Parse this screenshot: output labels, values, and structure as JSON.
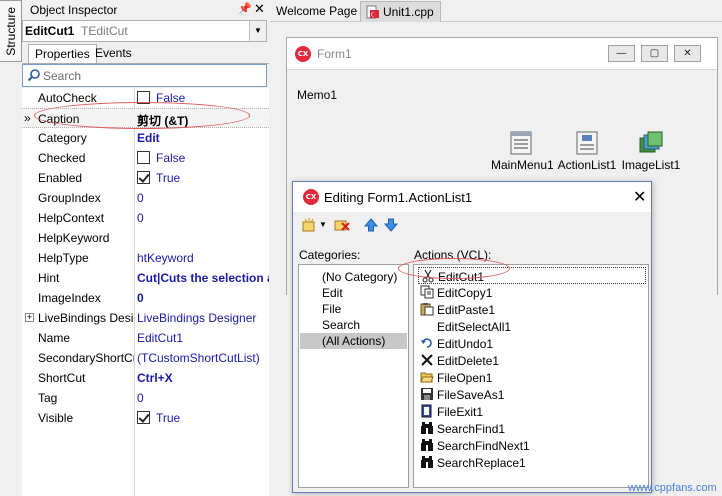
{
  "structure_tab": {
    "label": "Structure"
  },
  "object_inspector": {
    "title": "Object Inspector",
    "selected_component": {
      "name": "EditCut1",
      "class": "TEditCut"
    },
    "tabs": [
      {
        "label": "Properties"
      },
      {
        "label": "Events"
      }
    ],
    "search_placeholder": "Search",
    "properties": [
      {
        "name": "AutoCheck",
        "value": "False",
        "checkbox": "off"
      },
      {
        "name": "Caption",
        "value": "剪切 (&T)",
        "selected": true
      },
      {
        "name": "Category",
        "value": "Edit",
        "bold": true
      },
      {
        "name": "Checked",
        "value": "False",
        "checkbox": "off"
      },
      {
        "name": "Enabled",
        "value": "True",
        "checkbox": "on"
      },
      {
        "name": "GroupIndex",
        "value": "0"
      },
      {
        "name": "HelpContext",
        "value": "0"
      },
      {
        "name": "HelpKeyword",
        "value": ""
      },
      {
        "name": "HelpType",
        "value": "htKeyword"
      },
      {
        "name": "Hint",
        "value": "Cut|Cuts the selection a",
        "bold": true
      },
      {
        "name": "ImageIndex",
        "value": "0",
        "bold": true
      },
      {
        "name": "LiveBindings Designer",
        "value": "LiveBindings Designer",
        "expander": "+"
      },
      {
        "name": "Name",
        "value": "EditCut1"
      },
      {
        "name": "SecondaryShortCuts",
        "value": "(TCustomShortCutList)"
      },
      {
        "name": "ShortCut",
        "value": "Ctrl+X",
        "bold": true
      },
      {
        "name": "Tag",
        "value": "0"
      },
      {
        "name": "Visible",
        "value": "True",
        "checkbox": "on"
      }
    ]
  },
  "editor_tabs": [
    {
      "label": "Welcome Page"
    },
    {
      "label": "Unit1.cpp"
    }
  ],
  "form1": {
    "title": "Form1",
    "memo_label": "Memo1",
    "components": [
      {
        "label": "MainMenu1"
      },
      {
        "label": "ActionList1"
      },
      {
        "label": "ImageList1"
      }
    ]
  },
  "dialog": {
    "title": "Editing Form1.ActionList1",
    "categories_label": "Categories:",
    "actions_label": "Actions (VCL):",
    "categories": [
      {
        "label": "(No Category)"
      },
      {
        "label": "Edit"
      },
      {
        "label": "File"
      },
      {
        "label": "Search"
      },
      {
        "label": "(All Actions)",
        "selected": true
      }
    ],
    "actions": [
      {
        "label": "EditCut1",
        "icon": "scissors-icon",
        "selected": true
      },
      {
        "label": "EditCopy1",
        "icon": "copy-icon"
      },
      {
        "label": "EditPaste1",
        "icon": "paste-icon"
      },
      {
        "label": "EditSelectAll1",
        "icon": ""
      },
      {
        "label": "EditUndo1",
        "icon": "undo-icon"
      },
      {
        "label": "EditDelete1",
        "icon": "delete-icon"
      },
      {
        "label": "FileOpen1",
        "icon": "folder-open-icon"
      },
      {
        "label": "FileSaveAs1",
        "icon": "save-icon"
      },
      {
        "label": "FileExit1",
        "icon": "exit-icon"
      },
      {
        "label": "SearchFind1",
        "icon": "binoculars-icon"
      },
      {
        "label": "SearchFindNext1",
        "icon": "binoculars-icon"
      },
      {
        "label": "SearchReplace1",
        "icon": "binoculars-icon"
      }
    ]
  },
  "watermark": "www.cppfans.com",
  "colors": {
    "property_value": "#1a1aa6",
    "highlight_ellipse": "#e05a5a",
    "cx_logo": "#e0293d"
  }
}
